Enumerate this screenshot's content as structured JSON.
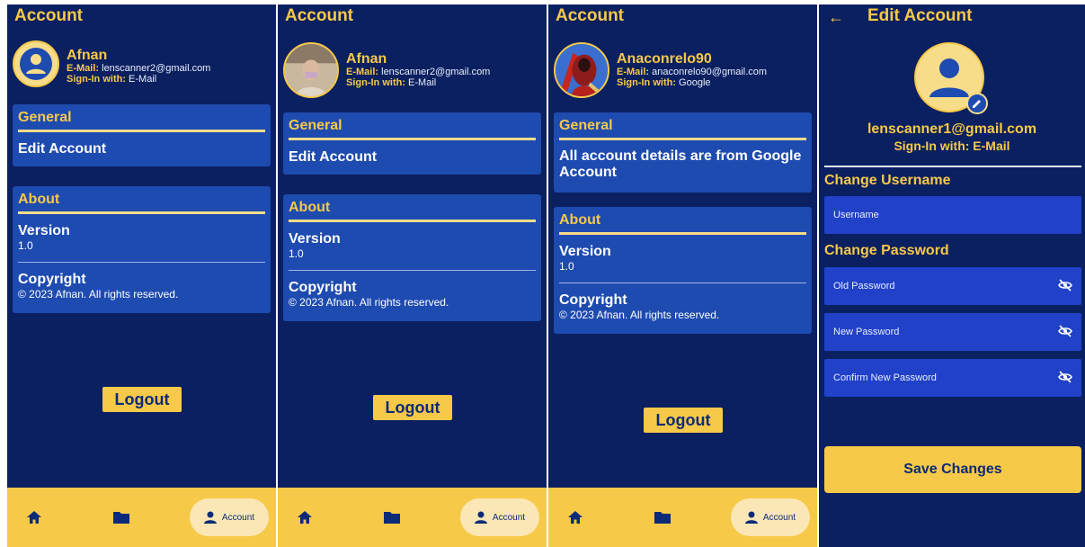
{
  "colors": {
    "background": "#0b2060",
    "accent": "#f7c948",
    "card": "#1e4bb0",
    "field": "#2141c9"
  },
  "screens": [
    {
      "title": "Account",
      "profile": {
        "name": "Afnan",
        "email_label": "E-Mail:",
        "email": "lenscanner2@gmail.com",
        "signin_label": "Sign-In with:",
        "signin": "E-Mail",
        "avatar": "person-icon"
      },
      "general": {
        "heading": "General",
        "item": "Edit Account"
      },
      "about": {
        "heading": "About",
        "version_label": "Version",
        "version": "1.0",
        "copyright_label": "Copyright",
        "copyright": "© 2023 Afnan. All rights reserved."
      },
      "logout": "Logout",
      "nav": {
        "active": "Account"
      }
    },
    {
      "title": "Account",
      "profile": {
        "name": "Afnan",
        "email_label": "E-Mail:",
        "email": "lenscanner2@gmail.com",
        "signin_label": "Sign-In with:",
        "signin": "E-Mail",
        "avatar": "photo-avatar"
      },
      "general": {
        "heading": "General",
        "item": "Edit Account"
      },
      "about": {
        "heading": "About",
        "version_label": "Version",
        "version": "1.0",
        "copyright_label": "Copyright",
        "copyright": "© 2023 Afnan. All rights reserved."
      },
      "logout": "Logout",
      "nav": {
        "active": "Account"
      }
    },
    {
      "title": "Account",
      "profile": {
        "name": "Anaconrelo90",
        "email_label": "E-Mail:",
        "email": "anaconrelo90@gmail.com",
        "signin_label": "Sign-In with:",
        "signin": "Google",
        "avatar": "illustrated-avatar"
      },
      "general": {
        "heading": "General",
        "item": "All account details are from Google Account"
      },
      "about": {
        "heading": "About",
        "version_label": "Version",
        "version": "1.0",
        "copyright_label": "Copyright",
        "copyright": "© 2023 Afnan. All rights reserved."
      },
      "logout": "Logout",
      "nav": {
        "active": "Account"
      }
    }
  ],
  "edit": {
    "title": "Edit Account",
    "email": "lenscanner1@gmail.com",
    "signin": "Sign-In with: E-Mail",
    "username_heading": "Change Username",
    "username_placeholder": "Username",
    "password_heading": "Change Password",
    "old_password": "Old Password",
    "new_password": "New Password",
    "confirm_password": "Confirm New Password",
    "save": "Save Changes"
  }
}
